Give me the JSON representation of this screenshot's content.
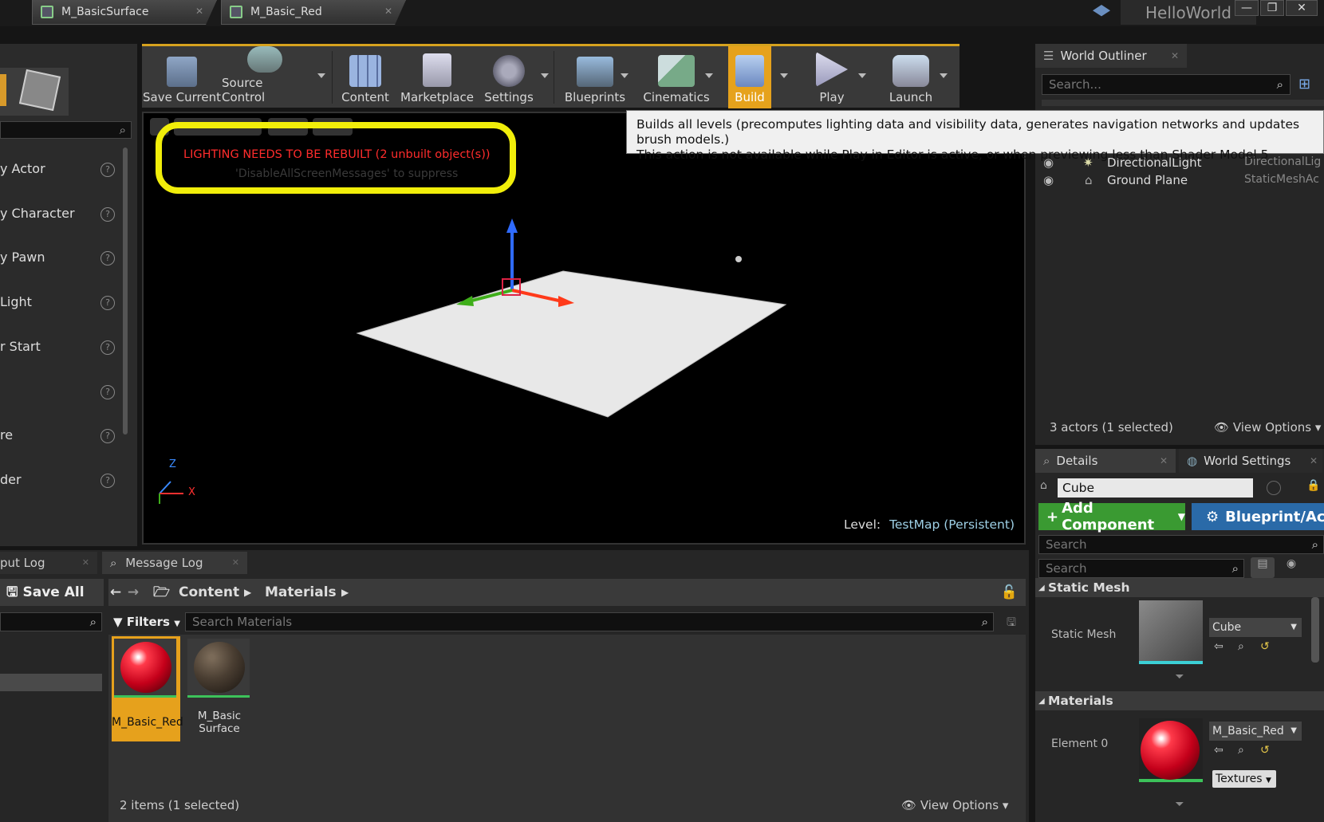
{
  "window": {
    "app_name": "HelloWorld",
    "minimize": "—",
    "restore": "❐",
    "close": "✕"
  },
  "doc_tabs": [
    {
      "label": "M_BasicSurface"
    },
    {
      "label": "M_Basic_Red"
    }
  ],
  "toolbar": {
    "buttons": [
      {
        "label": "Save Current"
      },
      {
        "label": "Source Control"
      },
      {
        "label": "Content"
      },
      {
        "label": "Marketplace"
      },
      {
        "label": "Settings"
      },
      {
        "label": "Blueprints"
      },
      {
        "label": "Cinematics"
      },
      {
        "label": "Build"
      },
      {
        "label": "Play"
      },
      {
        "label": "Launch"
      }
    ]
  },
  "modes_panel": {
    "items": [
      "y Actor",
      "y Character",
      "y Pawn",
      "Light",
      "r Start",
      "",
      "re",
      "der"
    ]
  },
  "viewport": {
    "warning": "LIGHTING NEEDS TO BE REBUILT (2 unbuilt object(s))",
    "warning_sub": "'DisableAllScreenMessages' to suppress",
    "level_label": "Level:",
    "level_value": "TestMap (Persistent)",
    "axis_x": "X",
    "axis_z": "Z"
  },
  "tooltip": {
    "line1": "Builds all levels (precomputes lighting data and visibility data, generates navigation networks and updates brush models.)",
    "line2": "This action is not available while Play in Editor is active, or when previewing less than Shader Model 5"
  },
  "outliner": {
    "title": "World Outliner",
    "search_placeholder": "Search...",
    "rows": [
      {
        "name": "DirectionalLight",
        "type": "DirectionalLig"
      },
      {
        "name": "Ground Plane",
        "type": "StaticMeshAc"
      }
    ],
    "status": "3 actors (1 selected)",
    "view_options": "View Options"
  },
  "details": {
    "tab1": "Details",
    "tab2": "World Settings",
    "object_name": "Cube",
    "add_component": "Add Component",
    "blueprint": "Blueprint/Ac",
    "search1": "Search",
    "search2": "Search",
    "sec_static_mesh": "Static Mesh",
    "static_mesh_label": "Static Mesh",
    "static_mesh_value": "Cube",
    "sec_materials": "Materials",
    "element_label": "Element 0",
    "material_value": "M_Basic_Red",
    "textures_btn": "Textures"
  },
  "bottom": {
    "tab_output": "put Log",
    "tab_message": "Message Log",
    "save_all": "Save All",
    "crumb1": "Content",
    "crumb2": "Materials",
    "filters": "Filters",
    "search_materials": "Search Materials",
    "assets": [
      {
        "name": "M_Basic_Red"
      },
      {
        "name": "M_Basic\nSurface"
      }
    ],
    "status": "2 items (1 selected)",
    "view_options": "View Options"
  }
}
